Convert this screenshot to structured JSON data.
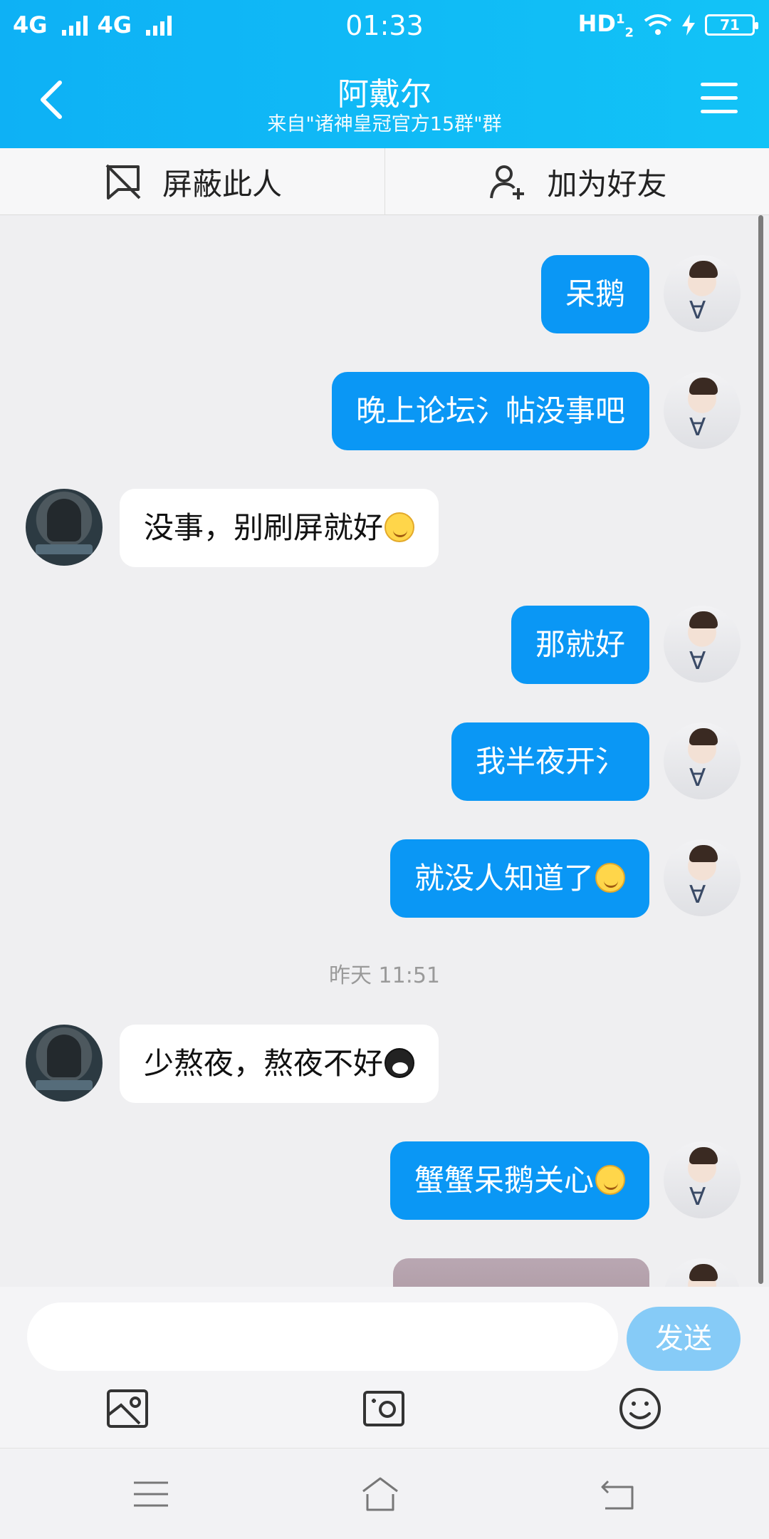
{
  "statusbar": {
    "network1": "4G",
    "network2": "4G",
    "time": "01:33",
    "hd": "HD",
    "hd_sup": "1",
    "hd_sub": "2",
    "battery": "71"
  },
  "header": {
    "title": "阿戴尔",
    "subtitle": "来自\"诸神皇冠官方15群\"群"
  },
  "actions": {
    "block_label": "屏蔽此人",
    "add_label": "加为好友"
  },
  "messages": [
    {
      "side": "me",
      "text": "呆鹅"
    },
    {
      "side": "me",
      "text": "晚上论坛氵帖没事吧"
    },
    {
      "side": "them",
      "text": "没事，别刷屏就好"
    },
    {
      "side": "me",
      "text": "那就好"
    },
    {
      "side": "me",
      "text": "我半夜开氵"
    },
    {
      "side": "me",
      "text": "就没人知道了"
    },
    {
      "side": "them",
      "text": "少熬夜，熬夜不好"
    },
    {
      "side": "me",
      "text": "蟹蟹呆鹅关心"
    }
  ],
  "timestamp": "昨天 11:51",
  "composer": {
    "placeholder": "",
    "send_label": "发送"
  },
  "colors": {
    "header": "#12c3f7",
    "my_bubble": "#0a97f5",
    "their_bubble": "#ffffff",
    "send_button": "#86cbf7"
  }
}
